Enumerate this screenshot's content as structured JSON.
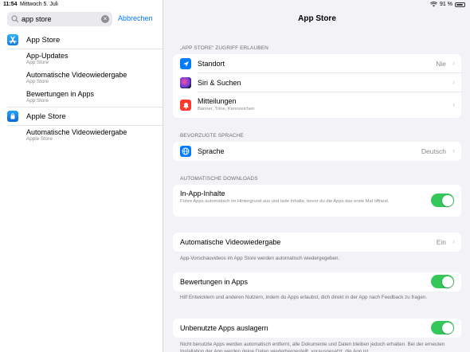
{
  "status": {
    "time": "11:54",
    "date": "Mittwoch 5. Juli",
    "battery": "91 %"
  },
  "sidebar": {
    "search_value": "app store",
    "cancel_label": "Abbrechen",
    "results": [
      {
        "title": "App Store",
        "subtitle": ""
      },
      {
        "title": "App-Updates",
        "subtitle": "App Store"
      },
      {
        "title": "Automatische Videowiedergabe",
        "subtitle": "App Store"
      },
      {
        "title": "Bewertungen in Apps",
        "subtitle": "App Store"
      },
      {
        "title": "Apple Store",
        "subtitle": ""
      },
      {
        "title": "Automatische Videowiedergabe",
        "subtitle": "Apple Store"
      }
    ]
  },
  "detail": {
    "title": "App Store",
    "sections": {
      "access": "„APP STORE“ ZUGRIFF ERLAUBEN",
      "language": "BEVORZUGTE SPRACHE",
      "downloads": "AUTOMATISCHE DOWNLOADS"
    },
    "access_rows": [
      {
        "label": "Standort",
        "value": "Nie",
        "sub": ""
      },
      {
        "label": "Siri & Suchen",
        "value": "",
        "sub": ""
      },
      {
        "label": "Mitteilungen",
        "value": "",
        "sub": "Banner, Töne, Kennzeichen"
      }
    ],
    "language_row": {
      "label": "Sprache",
      "value": "Deutsch"
    },
    "inapp": {
      "label": "In-App-Inhalte",
      "sub": "Führe Apps automatisch im Hintergrund aus und lade Inhalte, bevor du die Apps das erste Mal öffnest.",
      "on": true
    },
    "video": {
      "label": "Automatische Videowiedergabe",
      "value": "Ein",
      "note": "App-Vorschauvideos im App Store werden automatisch wiedergegeben."
    },
    "ratings": {
      "label": "Bewertungen in Apps",
      "note": "Hilf Entwicklern und anderen Nutzern, indem du Apps erlaubst, dich direkt in der App nach Feedback zu fragen.",
      "on": true
    },
    "offload": {
      "label": "Unbenutzte Apps auslagern",
      "note": "Nicht benutzte Apps werden automatisch entfernt, alle Dokumente und Daten bleiben jedoch erhalten. Bei der erneuten Installation der App werden deine Daten wiederhergestellt, vorausgesetzt, die App ist",
      "on": true
    }
  }
}
